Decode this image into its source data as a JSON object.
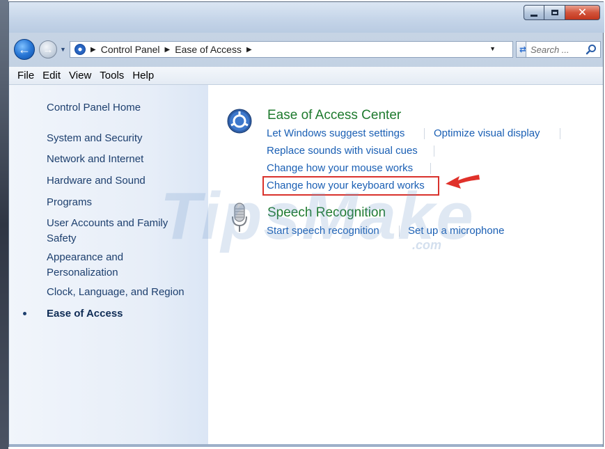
{
  "window": {
    "minimize_symbol": "",
    "maximize_symbol": "",
    "close_symbol": "✕"
  },
  "navigation": {
    "back_icon": "back-arrow-icon",
    "forward_icon": "forward-arrow-icon",
    "breadcrumbs": [
      "Control Panel",
      "Ease of Access"
    ],
    "search_placeholder": "Search ..."
  },
  "menubar": {
    "items": [
      "File",
      "Edit",
      "View",
      "Tools",
      "Help"
    ]
  },
  "sidebar": {
    "home": "Control Panel Home",
    "items": [
      "System and Security",
      "Network and Internet",
      "Hardware and Sound",
      "Programs",
      "User Accounts and Family Safety",
      "Appearance and Personalization",
      "Clock, Language, and Region",
      "Ease of Access"
    ],
    "current": "Ease of Access"
  },
  "sections": [
    {
      "title": "Ease of Access Center",
      "icon": "ease-of-access-icon",
      "links": [
        "Let Windows suggest settings",
        "Optimize visual display",
        "Replace sounds with visual cues",
        "Change how your mouse works",
        "Change how your keyboard works"
      ]
    },
    {
      "title": "Speech Recognition",
      "icon": "microphone-icon",
      "links": [
        "Start speech recognition",
        "Set up a microphone"
      ]
    }
  ],
  "watermark": {
    "text": "TipsMake",
    "suffix": ".com"
  },
  "colors": {
    "link": "#1a5fb4",
    "section_title": "#1e7a2e",
    "highlight": "#d9322c",
    "sidebar_text": "#1d3f6e"
  }
}
